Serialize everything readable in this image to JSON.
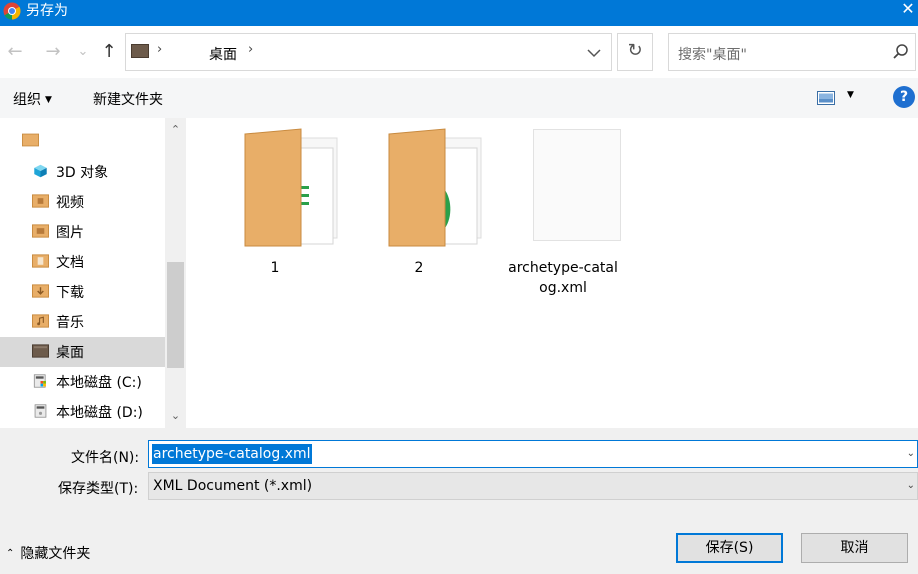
{
  "window": {
    "title": "另存为",
    "close_glyph": "✕",
    "icon": "chrome-icon"
  },
  "nav": {
    "back_glyph": "←",
    "forward_glyph": "→",
    "recent_glyph": "⌄",
    "up_glyph": "↑"
  },
  "address": {
    "separator": "›",
    "crumb": "桌面",
    "refresh_glyph": "↻"
  },
  "search": {
    "placeholder": "搜索\"桌面\""
  },
  "toolbar": {
    "organize_label": "组织",
    "organize_caret": "▼",
    "new_folder_label": "新建文件夹",
    "view_caret": "▼",
    "help_label": "?"
  },
  "sidebar": {
    "items": [
      {
        "label": "",
        "icon": "folder-icon"
      },
      {
        "label": "3D 对象",
        "icon": "3d-objects-icon"
      },
      {
        "label": "视频",
        "icon": "videos-folder-icon"
      },
      {
        "label": "图片",
        "icon": "pictures-folder-icon"
      },
      {
        "label": "文档",
        "icon": "documents-folder-icon"
      },
      {
        "label": "下载",
        "icon": "downloads-folder-icon"
      },
      {
        "label": "音乐",
        "icon": "music-folder-icon"
      },
      {
        "label": "桌面",
        "icon": "desktop-icon",
        "selected": true
      },
      {
        "label": "本地磁盘 (C:)",
        "icon": "drive-c-icon"
      },
      {
        "label": "本地磁盘 (D:)",
        "icon": "drive-d-icon"
      }
    ],
    "scroll_up_glyph": "⌃",
    "scroll_down_glyph": "⌄"
  },
  "files": [
    {
      "name": "1",
      "type": "folder",
      "icon": "folder-with-documents-icon"
    },
    {
      "name": "2",
      "type": "folder",
      "icon": "folder-with-documents-icon"
    },
    {
      "name": "archetype-catalog.xml",
      "type": "file",
      "icon": "blank-document-icon"
    }
  ],
  "form": {
    "filename_label": "文件名(N):",
    "filename_value": "archetype-catalog.xml",
    "filetype_label": "保存类型(T):",
    "filetype_value": "XML Document (*.xml)",
    "dropdown_glyph": "⌄"
  },
  "footer": {
    "hide_folders_label": "隐藏文件夹",
    "hide_folders_glyph": "⌃",
    "save_label": "保存(S)",
    "cancel_label": "取消"
  },
  "colors": {
    "titlebar": "#0078d7",
    "selection": "#0078d7",
    "folder": "#e8ae68",
    "help": "#1e6fd0"
  }
}
